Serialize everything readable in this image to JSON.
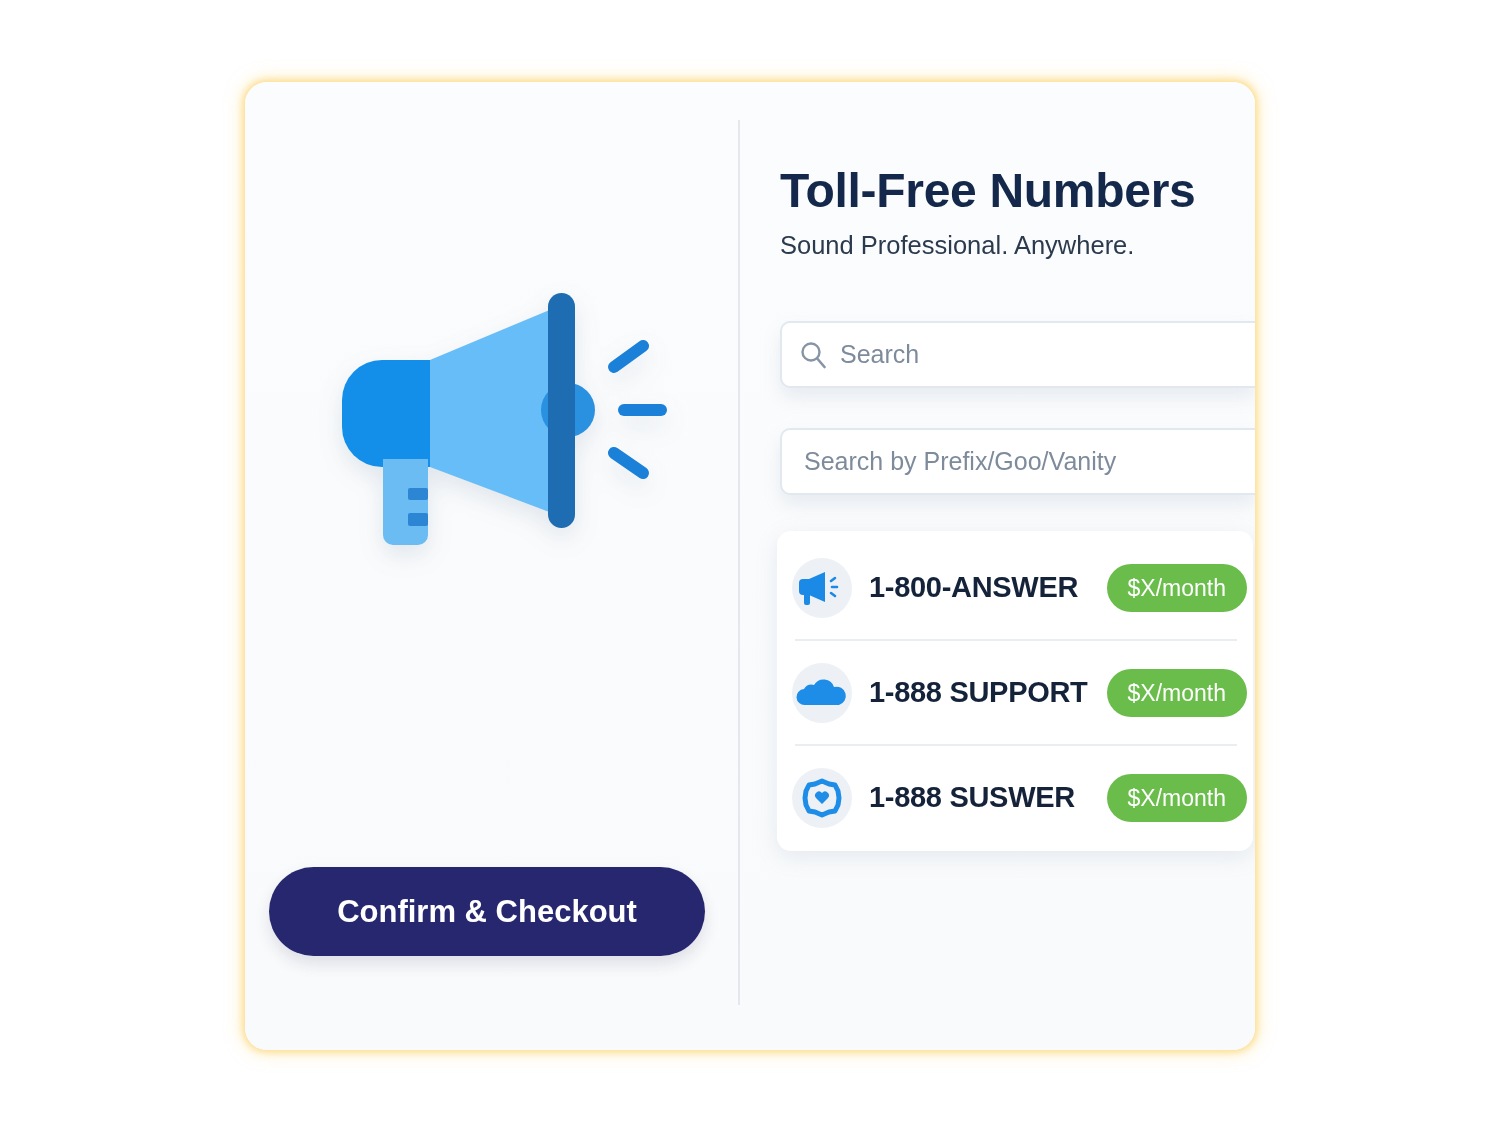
{
  "checkout_button": {
    "label": "Confirm & Checkout"
  },
  "header": {
    "title": "Toll-Free Numbers",
    "subtitle": "Sound Professional. Anywhere."
  },
  "search_fields": [
    {
      "kind": "search",
      "placeholder": "Search"
    },
    {
      "kind": "plain",
      "placeholder": "Search by Prefix/Goo/Vanity"
    }
  ],
  "numbers": [
    {
      "kind": "megaphone",
      "number": "1-800-ANSWER",
      "price": "$X/month"
    },
    {
      "kind": "cloud",
      "number": "1-888 SUPPORT",
      "price": "$X/month"
    },
    {
      "kind": "seal",
      "number": "1-888 SUSWER",
      "price": "$X/month"
    }
  ]
}
